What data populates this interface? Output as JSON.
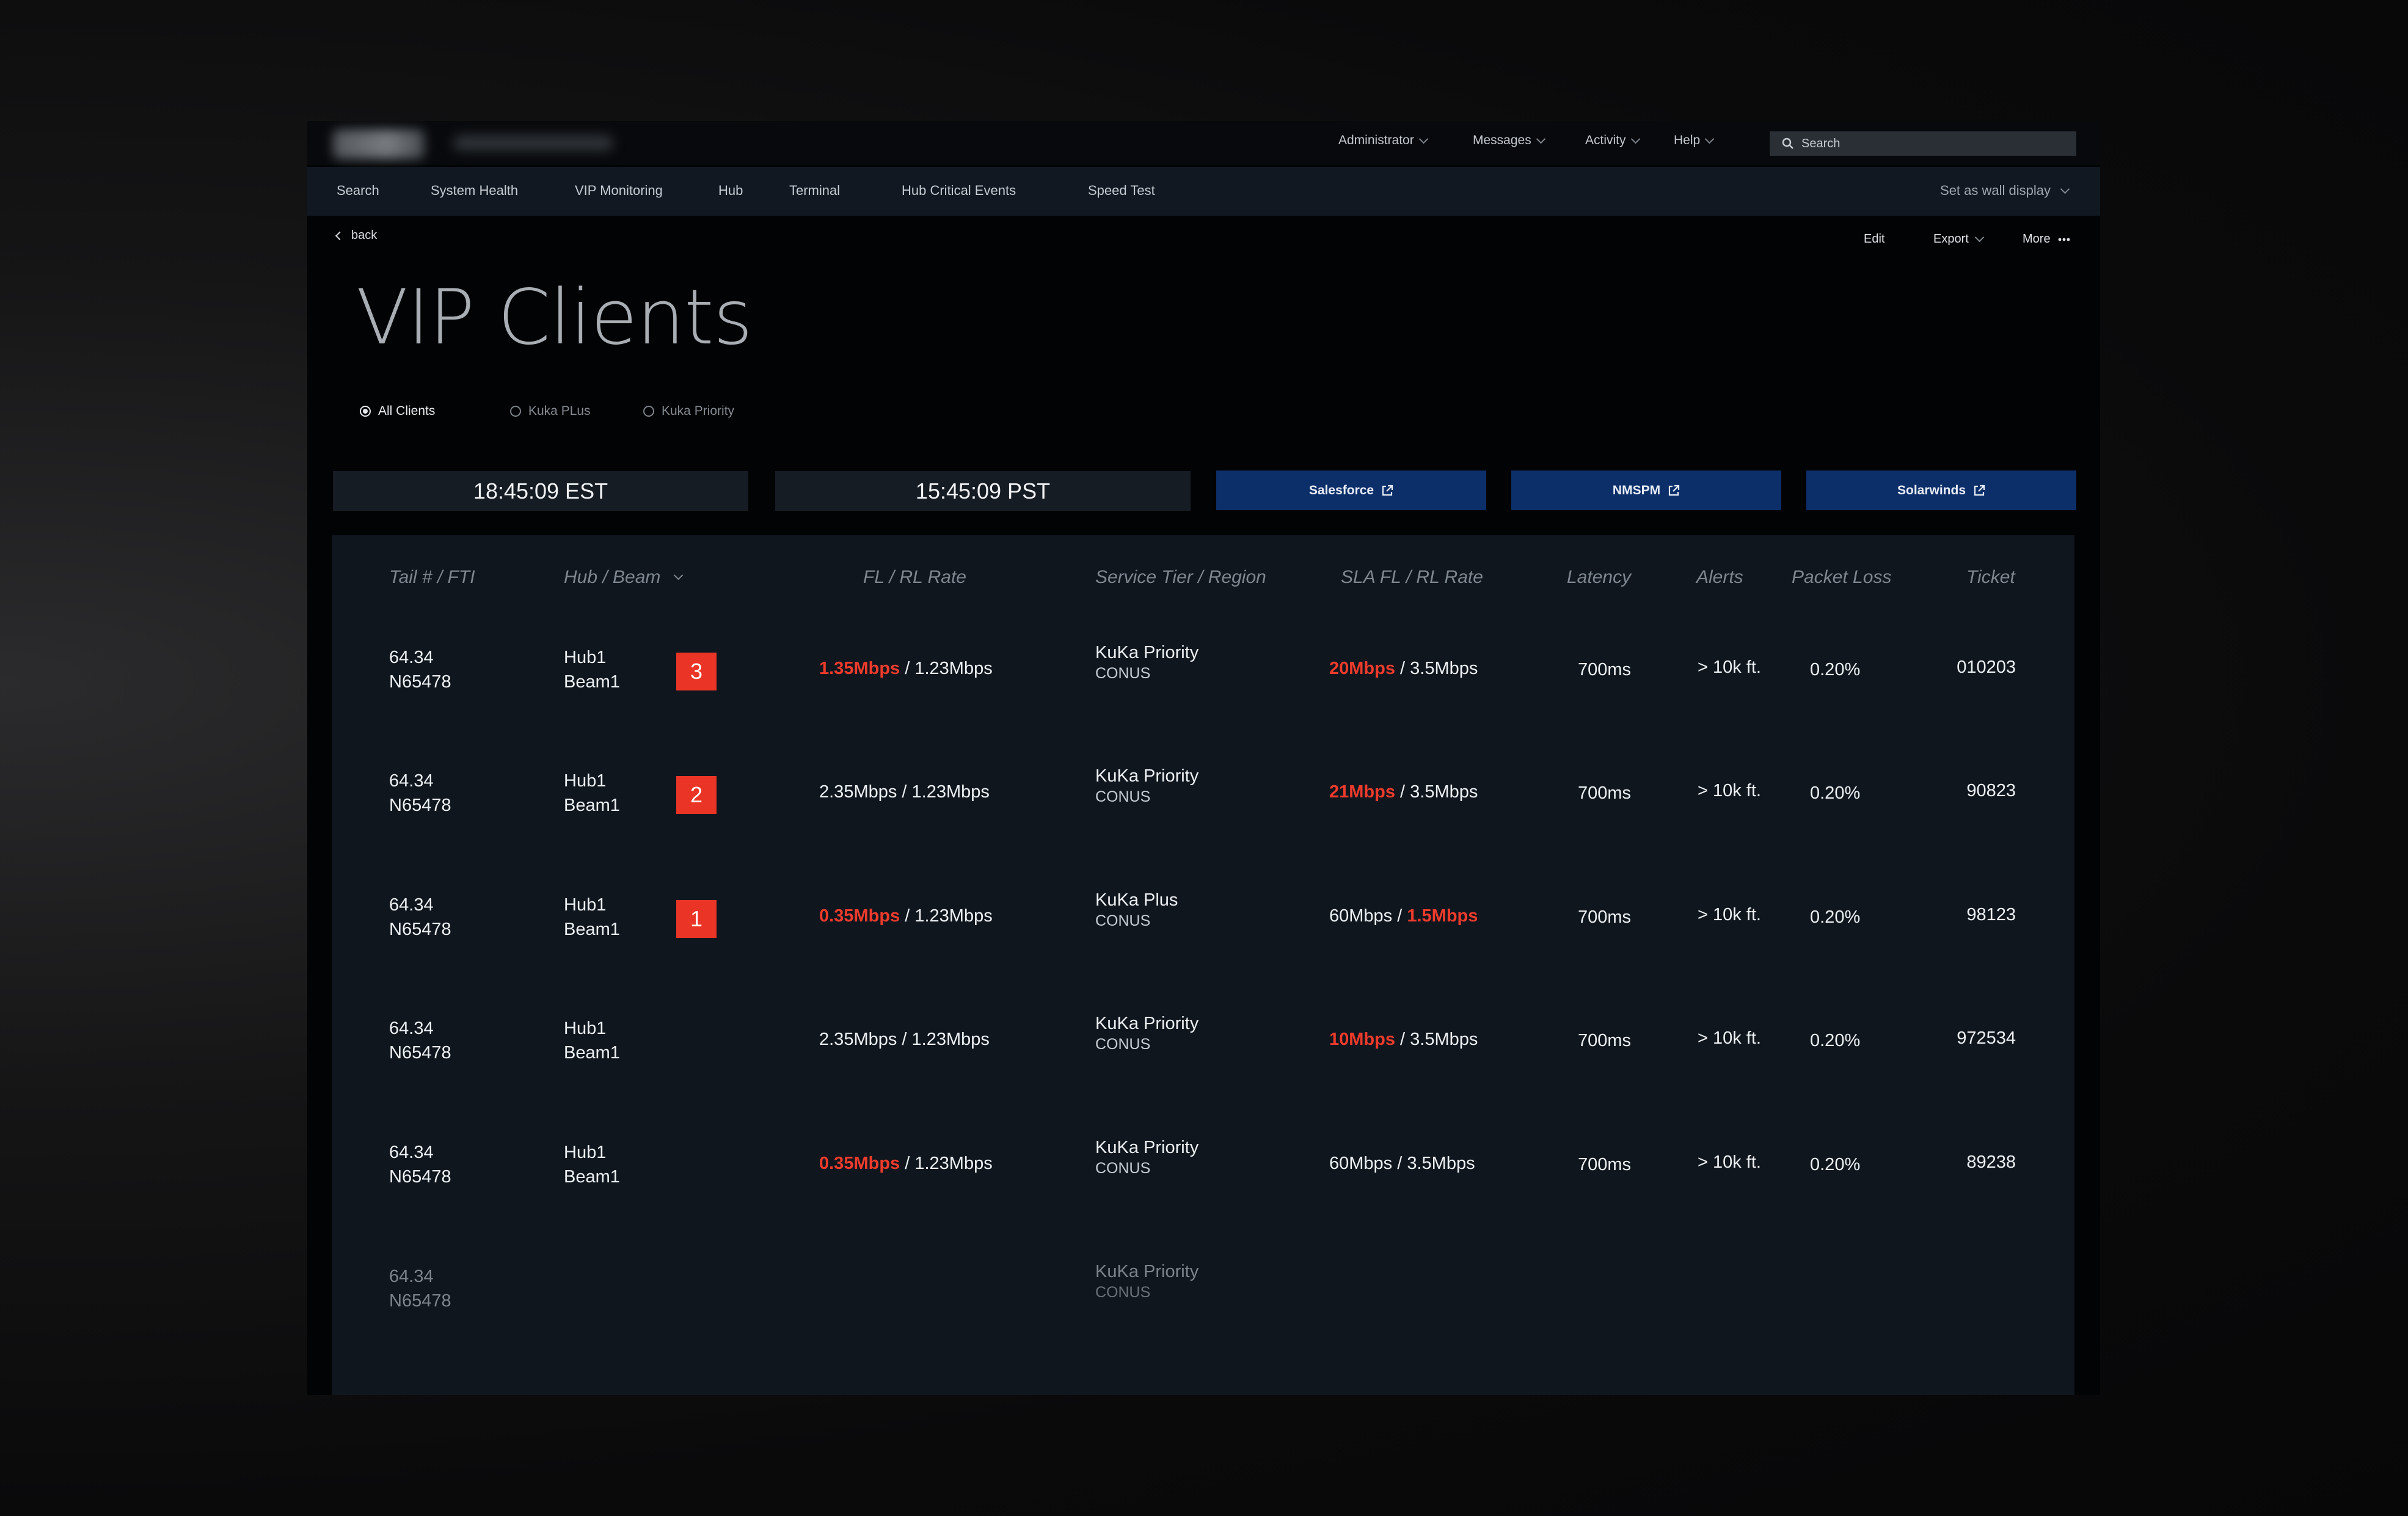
{
  "header": {
    "menus": [
      "Administrator",
      "Messages",
      "Activity",
      "Help"
    ],
    "search_placeholder": "Search"
  },
  "nav": {
    "items": [
      "Search",
      "System Health",
      "VIP Monitoring",
      "Hub",
      "Terminal",
      "Hub Critical Events",
      "Speed Test"
    ],
    "wall_display": "Set as wall display"
  },
  "actions": {
    "back": "back",
    "edit": "Edit",
    "export": "Export",
    "more": "More"
  },
  "page_title": "VIP Clients",
  "filters": {
    "options": [
      "All Clients",
      "Kuka PLus",
      "Kuka Priority"
    ],
    "selected": "All Clients"
  },
  "clocks": {
    "est": "18:45:09 EST",
    "pst": "15:45:09 PST"
  },
  "links": [
    "Salesforce",
    "NMSPM",
    "Solarwinds"
  ],
  "table": {
    "columns": [
      "Tail # / FTI",
      "Hub / Beam",
      "FL / RL Rate",
      "Service Tier / Region",
      "SLA FL / RL Rate",
      "Latency",
      "Alerts",
      "Packet Loss",
      "Ticket"
    ],
    "rows": [
      {
        "tail": "64.34",
        "fti": "N65478",
        "hub": "Hub1",
        "beam": "Beam1",
        "badge": "3",
        "fl": "1.35Mbps",
        "fl_alert": true,
        "rl": " / 1.23Mbps",
        "tier": "KuKa Priority",
        "region": "CONUS",
        "sla_fl": "20Mbps",
        "sla_fl_alert": true,
        "sla_rl": " / 3.5Mbps",
        "sla_rl_alert": false,
        "latency": "700ms",
        "alerts": "> 10k ft.",
        "loss": "0.20%",
        "ticket": "010203"
      },
      {
        "tail": "64.34",
        "fti": "N65478",
        "hub": "Hub1",
        "beam": "Beam1",
        "badge": "2",
        "fl": "2.35Mbps",
        "fl_alert": false,
        "rl": "  / 1.23Mbps",
        "tier": "KuKa Priority",
        "region": "CONUS",
        "sla_fl": "21Mbps",
        "sla_fl_alert": true,
        "sla_rl": " / 3.5Mbps",
        "sla_rl_alert": false,
        "latency": "700ms",
        "alerts": "> 10k ft.",
        "loss": "0.20%",
        "ticket": "90823"
      },
      {
        "tail": "64.34",
        "fti": "N65478",
        "hub": "Hub1",
        "beam": "Beam1",
        "badge": "1",
        "fl": "0.35Mbps",
        "fl_alert": true,
        "rl": " / 1.23Mbps",
        "tier": "KuKa Plus",
        "region": "CONUS",
        "sla_fl": "60Mbps /",
        "sla_fl_alert": false,
        "sla_rl": "1.5Mbps",
        "sla_rl_alert": true,
        "latency": "700ms",
        "alerts": "> 10k ft.",
        "loss": "0.20%",
        "ticket": "98123"
      },
      {
        "tail": "64.34",
        "fti": "N65478",
        "hub": "Hub1",
        "beam": "Beam1",
        "badge": "",
        "fl": "2.35Mbps",
        "fl_alert": false,
        "rl": "  / 1.23Mbps",
        "tier": "KuKa Priority",
        "region": "CONUS",
        "sla_fl": "10Mbps",
        "sla_fl_alert": true,
        "sla_rl": " / 3.5Mbps",
        "sla_rl_alert": false,
        "latency": "700ms",
        "alerts": "> 10k ft.",
        "loss": "0.20%",
        "ticket": "972534"
      },
      {
        "tail": "64.34",
        "fti": "N65478",
        "hub": "Hub1",
        "beam": "Beam1",
        "badge": "",
        "fl": "0.35Mbps",
        "fl_alert": true,
        "rl": " / 1.23Mbps",
        "tier": "KuKa Priority",
        "region": "CONUS",
        "sla_fl": "60Mbps",
        "sla_fl_alert": false,
        "sla_rl": "  / 3.5Mbps",
        "sla_rl_alert": false,
        "latency": "700ms",
        "alerts": "> 10k ft.",
        "loss": "0.20%",
        "ticket": "89238"
      },
      {
        "tail": "64.34",
        "fti": "N65478",
        "hub": "",
        "beam": "",
        "badge": "",
        "fl": "",
        "fl_alert": false,
        "rl": "",
        "tier": "KuKa Priority",
        "region": "CONUS",
        "sla_fl": "",
        "sla_fl_alert": false,
        "sla_rl": "",
        "sla_rl_alert": false,
        "latency": "",
        "alerts": "",
        "loss": "",
        "ticket": ""
      }
    ]
  },
  "colors": {
    "alert_red": "#ef3b2c",
    "link_blue": "#0c2f69",
    "panel": "#0f161e"
  }
}
